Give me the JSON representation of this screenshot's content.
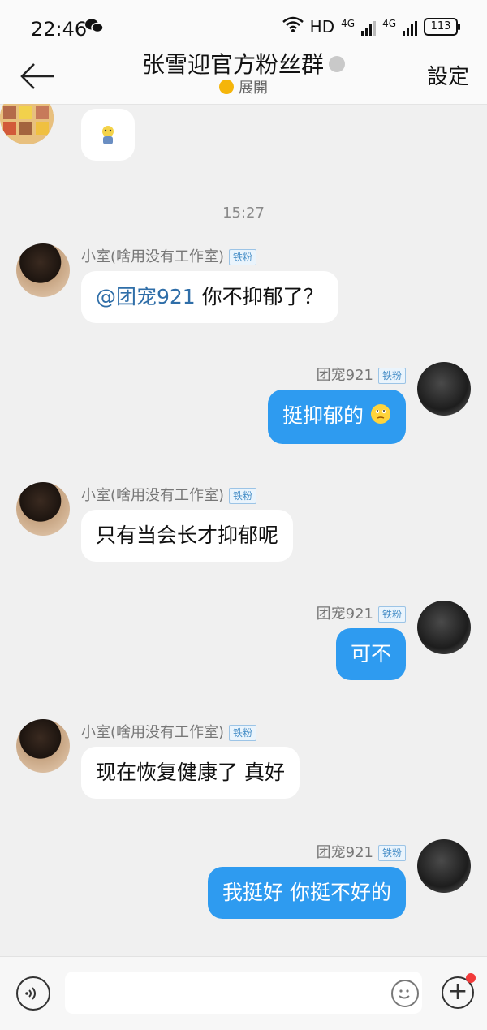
{
  "status": {
    "time": "22:46",
    "hd": "HD",
    "net1": "4G",
    "net2": "4G",
    "battery": "113"
  },
  "header": {
    "title": "张雪迎官方粉丝群",
    "expand_label": "展開",
    "settings_label": "設定"
  },
  "timestamp": "15:27",
  "badge_label": "铁粉",
  "messages": [
    {
      "sender": "小室(啥用没有工作室)",
      "mention": "@团宠921",
      "text": " 你不抑郁了？"
    },
    {
      "sender": "团宠921",
      "text": "挺抑郁的"
    },
    {
      "sender": "小室(啥用没有工作室)",
      "text": "只有当会长才抑郁呢"
    },
    {
      "sender": "团宠921",
      "text": "可不"
    },
    {
      "sender": "小室(啥用没有工作室)",
      "text": "现在恢复健康了 真好"
    },
    {
      "sender": "团宠921",
      "text": "我挺好 你挺不好的"
    }
  ],
  "input": {
    "placeholder": ""
  },
  "icons": [
    "wechat-icon",
    "wifi-icon",
    "back-arrow-icon",
    "verified-icon",
    "voice-icon",
    "emoji-icon",
    "plus-icon",
    "sticker-icon"
  ]
}
